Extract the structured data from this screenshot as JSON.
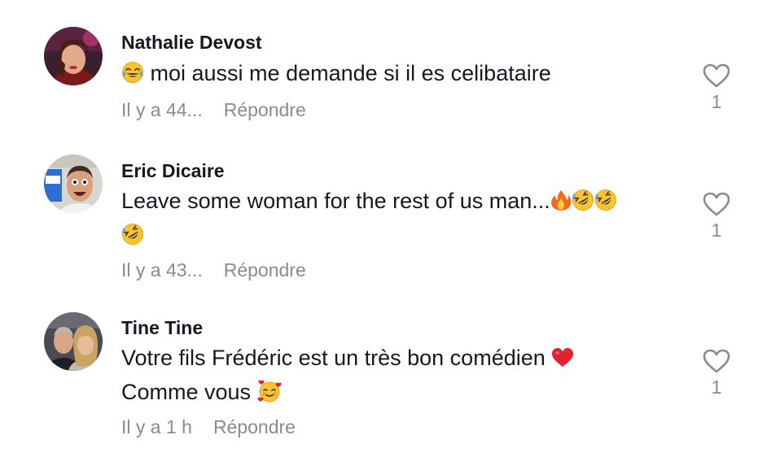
{
  "comments": [
    {
      "username": "Nathalie Devost",
      "text": "moi aussi me demande si il es celibataire",
      "time": "Il y a 44...",
      "reply_label": "Répondre",
      "likes": "1"
    },
    {
      "username": "Eric Dicaire",
      "text": "Leave some woman for the rest of us man...",
      "time": "Il y a 43...",
      "reply_label": "Répondre",
      "likes": "1"
    },
    {
      "username": "Tine Tine",
      "text_line1": "Votre fils Frédéric est un très bon comédien",
      "text_line2": "Comme vous",
      "time": "Il y a 1 h",
      "reply_label": "Répondre",
      "likes": "1"
    }
  ],
  "icons": {
    "like": "heart-outline-icon",
    "emoji_laugh": "tears-of-joy-emoji",
    "emoji_fire": "fire-emoji",
    "emoji_rofl": "rolling-on-floor-laughing-emoji",
    "emoji_heart": "red-heart-emoji",
    "emoji_hearts": "smiling-face-with-hearts-emoji"
  },
  "colors": {
    "text": "#161823",
    "muted": "#8a8b91",
    "heart_stroke": "#8a8b91"
  }
}
